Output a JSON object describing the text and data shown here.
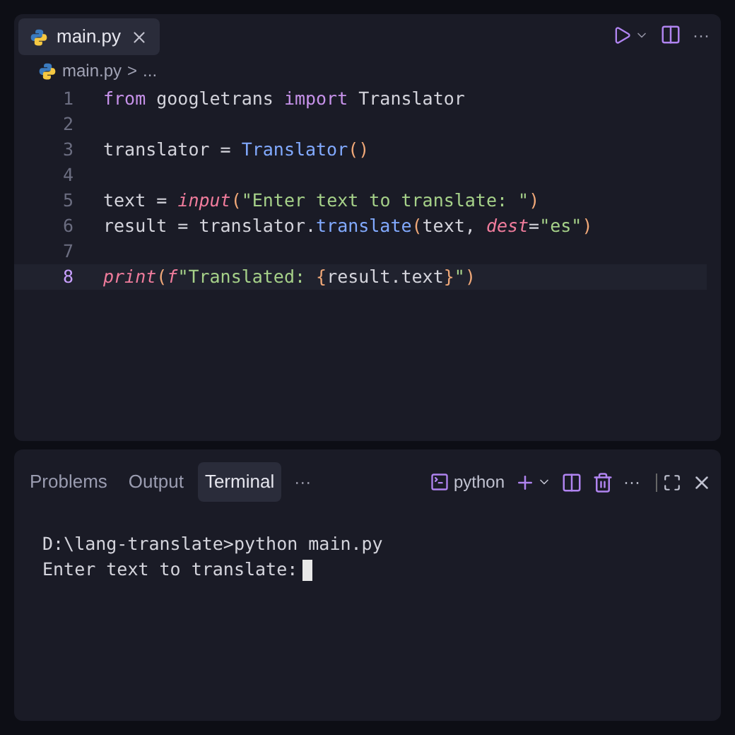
{
  "editor_tabs": [
    {
      "label": "main.py",
      "selected": true
    }
  ],
  "breadcrumb": {
    "file": "main.py",
    "separator": ">",
    "rest": "..."
  },
  "code_lines": [
    {
      "number": "1",
      "current": false,
      "tokens": [
        {
          "kind": "keyword",
          "text": "from"
        },
        {
          "kind": "plain",
          "text": " googletrans "
        },
        {
          "kind": "keyword",
          "text": "import"
        },
        {
          "kind": "plain",
          "text": " Translator"
        }
      ]
    },
    {
      "number": "2",
      "current": false
    },
    {
      "number": "3",
      "current": false,
      "tokens": [
        {
          "kind": "plain",
          "text": "translator = "
        },
        {
          "kind": "type",
          "text": "Translator"
        },
        {
          "kind": "paren",
          "text": "()"
        }
      ]
    },
    {
      "number": "4",
      "current": false
    },
    {
      "number": "5",
      "current": false,
      "tokens": [
        {
          "kind": "plain",
          "text": "text = "
        },
        {
          "kind": "builtin",
          "text": "input"
        },
        {
          "kind": "paren",
          "text": "("
        },
        {
          "kind": "string",
          "text": "\"Enter text to translate: \""
        },
        {
          "kind": "paren",
          "text": ")"
        }
      ]
    },
    {
      "number": "6",
      "current": false,
      "tokens": [
        {
          "kind": "plain",
          "text": "result = translator."
        },
        {
          "kind": "type",
          "text": "translate"
        },
        {
          "kind": "paren",
          "text": "("
        },
        {
          "kind": "plain",
          "text": "text, "
        },
        {
          "kind": "builtin",
          "text": "dest"
        },
        {
          "kind": "plain",
          "text": "="
        },
        {
          "kind": "string",
          "text": "\"es\""
        },
        {
          "kind": "paren",
          "text": ")"
        }
      ]
    },
    {
      "number": "7",
      "current": false
    },
    {
      "number": "8",
      "current": true,
      "tokens": [
        {
          "kind": "builtin",
          "text": "print"
        },
        {
          "kind": "paren",
          "text": "("
        },
        {
          "kind": "builtin",
          "text": "f"
        },
        {
          "kind": "string",
          "text": "\"Translated: "
        },
        {
          "kind": "paren",
          "text": "{"
        },
        {
          "kind": "plain",
          "text": "result.text"
        },
        {
          "kind": "paren",
          "text": "}"
        },
        {
          "kind": "string",
          "text": "\""
        },
        {
          "kind": "paren",
          "text": ")"
        }
      ]
    }
  ],
  "panel_tabs": [
    {
      "label": "Problems",
      "selected": false
    },
    {
      "label": "Output",
      "selected": false
    },
    {
      "label": "Terminal",
      "selected": true
    }
  ],
  "panel_more": "···",
  "terminal_name": "python",
  "toolbar_more": "···",
  "editor_more": "···",
  "terminal_lines": [
    "D:\\lang-translate>python main.py",
    "Enter text to translate:"
  ]
}
